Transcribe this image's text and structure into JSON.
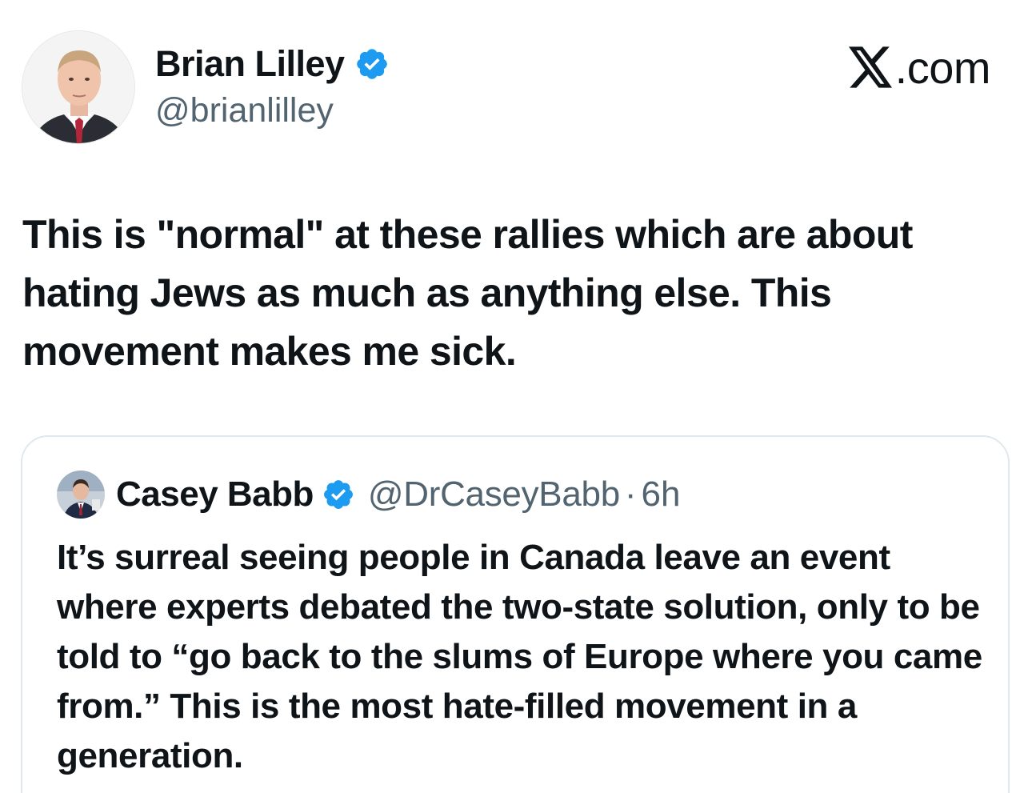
{
  "tweet": {
    "author": {
      "name": "Brian Lilley",
      "handle": "@brianlilley",
      "verified": true
    },
    "source_label": ".com",
    "text": "This is \"normal\" at these rallies which are about hating Jews as much as anything else. This movement makes me sick."
  },
  "quoted_tweet": {
    "author": {
      "name": "Casey Babb",
      "handle": "@DrCaseyBabb",
      "verified": true
    },
    "separator": "·",
    "time": "6h",
    "text": "It’s surreal seeing people in Canada leave an event where experts debated the two-state solution, only to be told to “go back to the slums of Europe where you came from.” This is the most hate-filled movement in a generation."
  },
  "colors": {
    "text_primary": "#0f1419",
    "text_secondary": "#536471",
    "verified_blue": "#1d9bf0",
    "card_border": "#e1e8ed"
  },
  "icons": {
    "verified": "verified-badge-icon",
    "brand": "x-logo-icon"
  }
}
